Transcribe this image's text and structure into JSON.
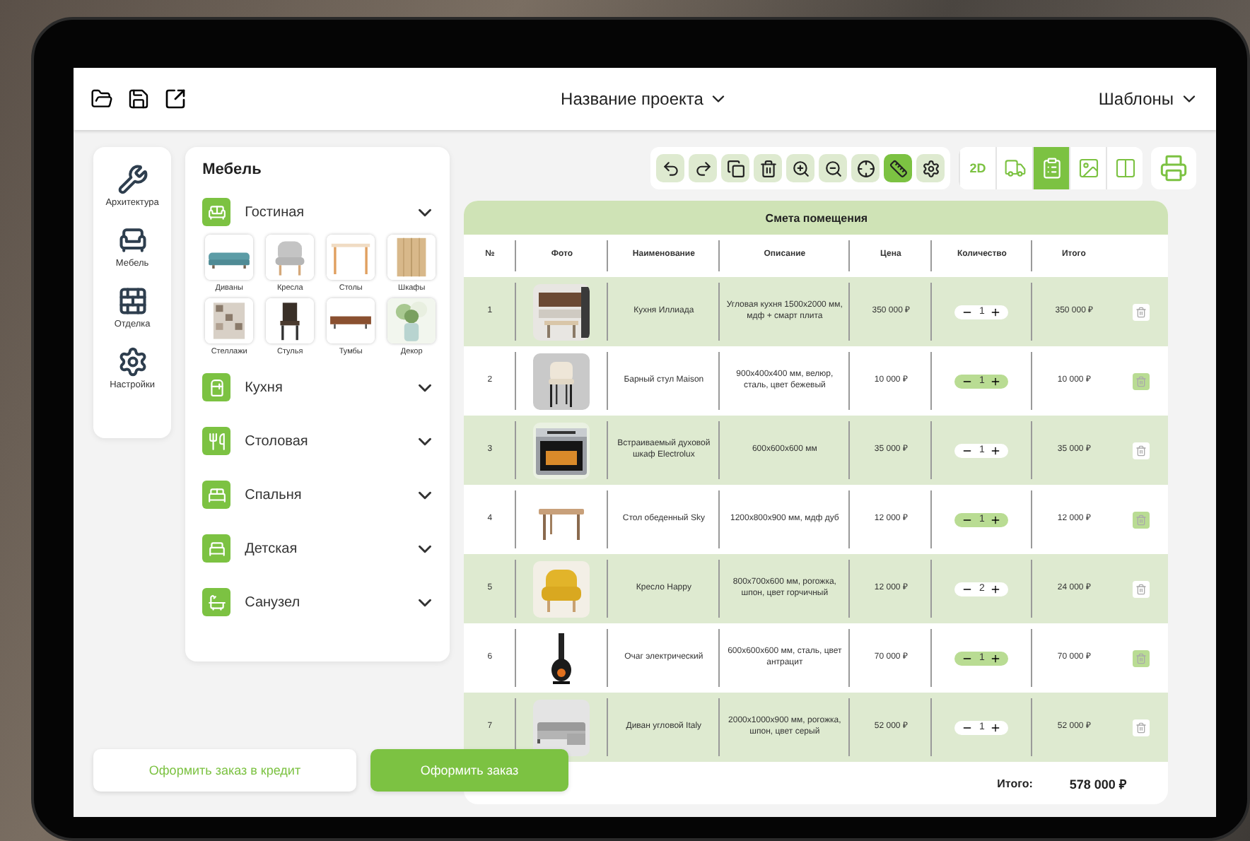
{
  "top_bar": {
    "project": "Название проекта",
    "templates": "Шаблоны"
  },
  "nav": [
    {
      "label": "Архитектура"
    },
    {
      "label": "Мебель"
    },
    {
      "label": "Отделка"
    },
    {
      "label": "Настройки"
    }
  ],
  "panel": {
    "title": "Мебель",
    "categories": [
      {
        "label": "Гостиная",
        "items": [
          "Диваны",
          "Кресла",
          "Столы",
          "Шкафы",
          "Стеллажи",
          "Стулья",
          "Тумбы",
          "Декор"
        ]
      },
      {
        "label": "Кухня"
      },
      {
        "label": "Столовая"
      },
      {
        "label": "Спальня"
      },
      {
        "label": "Детская"
      },
      {
        "label": "Санузел"
      }
    ]
  },
  "toolbar": [
    {
      "selected": false
    },
    {
      "selected": false
    },
    {
      "selected": false
    },
    {
      "selected": false
    },
    {
      "selected": false
    },
    {
      "selected": false
    },
    {
      "selected": false
    },
    {
      "selected": true
    },
    {
      "selected": false
    }
  ],
  "views": [
    {
      "label": "2D",
      "selected": false
    },
    {
      "selected": false
    },
    {
      "selected": true
    },
    {
      "selected": false
    },
    {
      "selected": false
    }
  ],
  "table": {
    "title": "Смета помещения",
    "columns": [
      "№",
      "Фото",
      "Наименование",
      "Описание",
      "Цена",
      "Количество",
      "Итого"
    ],
    "rows": [
      {
        "no": "1",
        "name": "Кухня Иллиада",
        "description": "Угловая кухня 1500x2000 мм, мдф + смарт плита",
        "price": "350 000 ₽",
        "qty": "1",
        "total": "350 000 ₽"
      },
      {
        "no": "2",
        "name": "Барный стул Maison",
        "description": "900x400x400 мм, велюр, сталь, цвет бежевый",
        "price": "10 000 ₽",
        "qty": "1",
        "total": "10 000 ₽"
      },
      {
        "no": "3",
        "name": "Встраиваемый духовой шкаф Electrolux",
        "description": "600x600x600 мм",
        "price": "35 000 ₽",
        "qty": "1",
        "total": "35 000 ₽"
      },
      {
        "no": "4",
        "name": "Стол обеденный Sky",
        "description": "1200x800x900 мм, мдф дуб",
        "price": "12 000 ₽",
        "qty": "1",
        "total": "12 000 ₽"
      },
      {
        "no": "5",
        "name": "Кресло Happy",
        "description": "800x700x600 мм, рогожка, шпон, цвет горчичный",
        "price": "12 000 ₽",
        "qty": "2",
        "total": "24 000 ₽"
      },
      {
        "no": "6",
        "name": "Очаг электрический",
        "description": "600x600x600 мм, сталь, цвет антрацит",
        "price": "70 000 ₽",
        "qty": "1",
        "total": "70 000 ₽"
      },
      {
        "no": "7",
        "name": "Диван угловой Italy",
        "description": "2000x1000x900 мм, рогожка, шпон, цвет серый",
        "price": "52 000 ₽",
        "qty": "1",
        "total": "52 000 ₽"
      }
    ],
    "total_label": "Итого:",
    "total_value": "578 000 ₽"
  },
  "buttons": {
    "credit": "Оформить заказ в кредит",
    "order": "Оформить заказ"
  }
}
